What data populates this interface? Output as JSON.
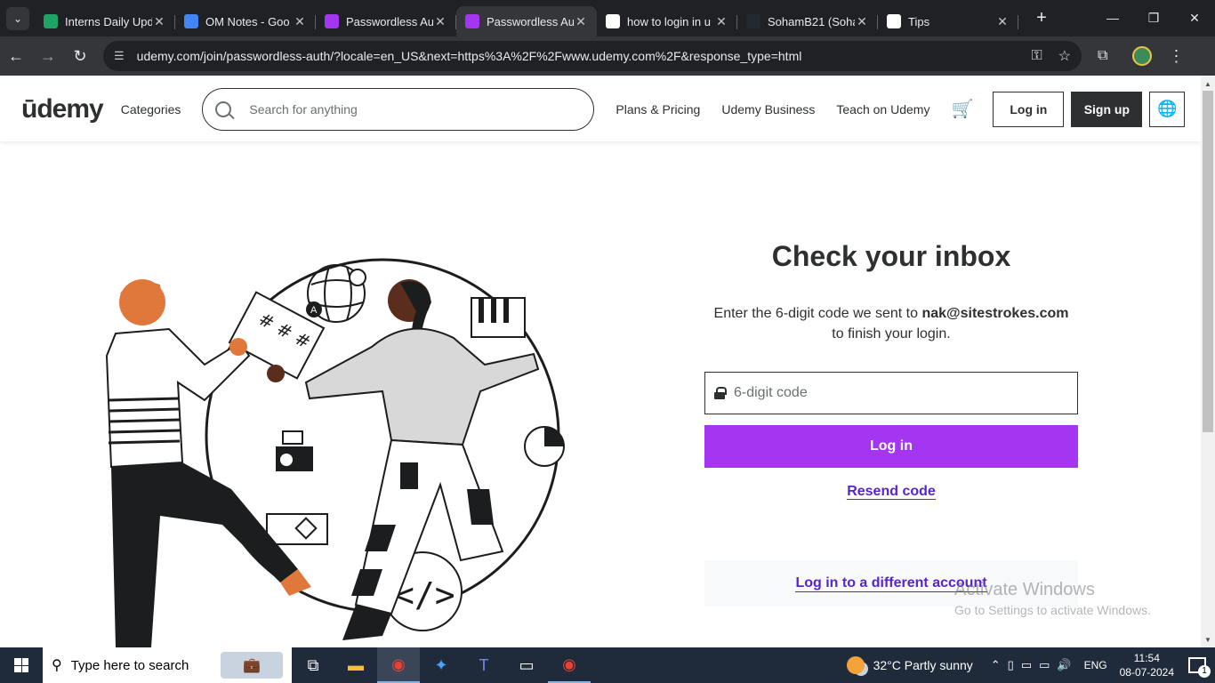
{
  "browser": {
    "tabs": [
      {
        "title": "Interns Daily Upd",
        "favicon_color": "#1ea362",
        "favicon_glyph": "sheets-icon",
        "active": false
      },
      {
        "title": "OM Notes - Goo",
        "favicon_color": "#4285f4",
        "favicon_glyph": "docs-icon",
        "active": false
      },
      {
        "title": "Passwordless Au",
        "favicon_color": "#a435f0",
        "favicon_glyph": "udemy-icon",
        "active": false
      },
      {
        "title": "Passwordless Au",
        "favicon_color": "#a435f0",
        "favicon_glyph": "udemy-icon",
        "active": true
      },
      {
        "title": "how to login in u",
        "favicon_color": "#ffffff",
        "favicon_glyph": "google-icon",
        "active": false
      },
      {
        "title": "SohamB21 (Soha",
        "favicon_color": "#24292f",
        "favicon_glyph": "github-icon",
        "active": false
      },
      {
        "title": "Tips",
        "favicon_color": "#ffffff",
        "favicon_glyph": "openai-icon",
        "active": false
      }
    ],
    "url": "udemy.com/join/passwordless-auth/?locale=en_US&next=https%3A%2F%2Fwww.udemy.com%2F&response_type=html"
  },
  "header": {
    "logo": "ūdemy",
    "categories": "Categories",
    "search_placeholder": "Search for anything",
    "plans": "Plans & Pricing",
    "business": "Udemy Business",
    "teach": "Teach on Udemy",
    "login": "Log in",
    "signup": "Sign up"
  },
  "main": {
    "title": "Check your inbox",
    "desc_prefix": "Enter the 6-digit code we sent to ",
    "email": "nak@sitestrokes.com",
    "desc_suffix": "to finish your login.",
    "code_placeholder": "6-digit code",
    "login_button": "Log in",
    "resend": "Resend code",
    "different_account": "Log in to a different account"
  },
  "watermark": {
    "line1": "Activate Windows",
    "line2": "Go to Settings to activate Windows."
  },
  "taskbar": {
    "search_placeholder": "Type here to search",
    "weather": "32°C  Partly sunny",
    "lang": "ENG",
    "time": "11:54",
    "date": "08-07-2024",
    "notifications": "1"
  },
  "colors": {
    "accent": "#a435f0",
    "link": "#5624d0",
    "text": "#2d2f31"
  }
}
